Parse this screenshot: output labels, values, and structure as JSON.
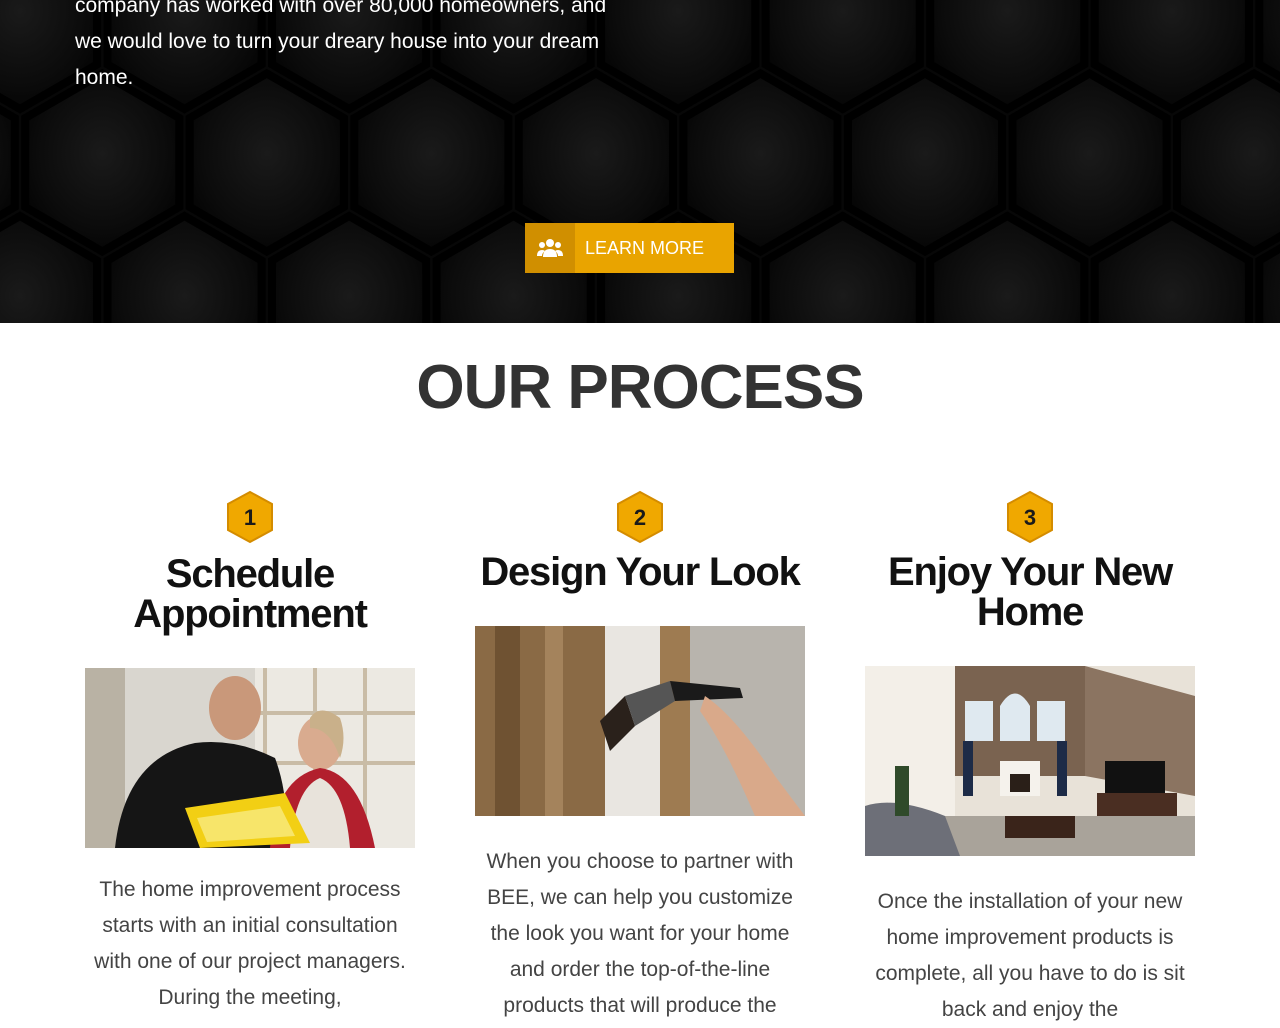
{
  "hero": {
    "text": "company has worked with over 80,000 homeowners, and we would love to turn your dreary house into your dream home.",
    "button": {
      "label": "LEARN MORE",
      "icon": "users-icon"
    }
  },
  "process": {
    "title": "OUR PROCESS",
    "steps": [
      {
        "number": "1",
        "title": "Schedule Appointment",
        "photo": "consultation-photo",
        "text": "The home improvement process starts with an initial consultation with one of our project managers. During the meeting,"
      },
      {
        "number": "2",
        "title": "Design Your Look",
        "photo": "paintbrush-photo",
        "text": "When you choose to partner with BEE, we can help you customize the look you want for your home and order the top-of-the-line products that will produce the"
      },
      {
        "number": "3",
        "title": "Enjoy Your New Home",
        "photo": "living-room-photo",
        "text": "Once the installation of your new home improvement products is complete, all you have to do is sit back and enjoy the"
      }
    ]
  },
  "colors": {
    "accent": "#e9a400",
    "accent_dark": "#d08f00",
    "hero_bg": "#070707",
    "title_text": "#333333",
    "body_text": "#444444"
  }
}
